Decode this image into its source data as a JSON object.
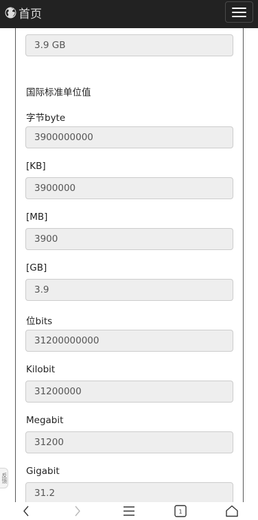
{
  "nav": {
    "home_label": "首页",
    "icon": "globe-icon"
  },
  "top_field": {
    "value": "3.9 GB"
  },
  "section_title": "国际标准单位值",
  "fields": [
    {
      "label": "字节byte",
      "value": "3900000000"
    },
    {
      "label": "[KB]",
      "value": "3900000"
    },
    {
      "label": "[MB]",
      "value": "3900"
    },
    {
      "label": "[GB]",
      "value": "3.9"
    },
    {
      "label": "位bits",
      "value": "31200000000"
    },
    {
      "label": "Kilobit",
      "value": "31200000"
    },
    {
      "label": "Megabit",
      "value": "31200"
    },
    {
      "label": "Gigabit",
      "value": "31.2"
    }
  ],
  "side_tab_text": "反馈",
  "tabs_count": "1",
  "colors": {
    "topbar": "#222222",
    "field_bg": "#eeeeee",
    "field_border": "#cccccc"
  }
}
